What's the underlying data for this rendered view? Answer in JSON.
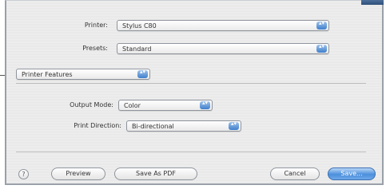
{
  "dialog": {
    "printer_label": "Printer:",
    "printer_value": "Stylus C80",
    "presets_label": "Presets:",
    "presets_value": "Standard",
    "panel_value": "Printer Features",
    "output_mode_label": "Output Mode:",
    "output_mode_value": "Color",
    "print_direction_label": "Print Direction:",
    "print_direction_value": "Bi-directional"
  },
  "buttons": {
    "help": "?",
    "preview": "Preview",
    "save_as_pdf": "Save As PDF",
    "cancel": "Cancel",
    "save": "Save..."
  },
  "icons": {
    "popup_arrows": "▴▾"
  },
  "colors": {
    "accent": "#4b8fdc",
    "sheet_bg": "#ececec"
  }
}
